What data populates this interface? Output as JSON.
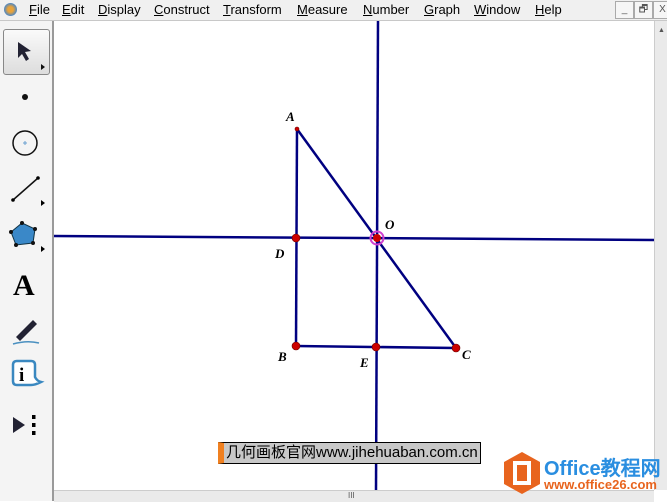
{
  "menu": [
    "File",
    "Edit",
    "Display",
    "Construct",
    "Transform",
    "Measure",
    "Number",
    "Graph",
    "Window",
    "Help"
  ],
  "window_buttons": [
    "_",
    "🗗",
    "X"
  ],
  "tools": [
    "arrow-tool",
    "point-tool",
    "compass-tool",
    "straightedge-tool",
    "polygon-tool",
    "text-tool",
    "marker-tool",
    "information-tool",
    "custom-tool"
  ],
  "points": {
    "A": "A",
    "B": "B",
    "C": "C",
    "D": "D",
    "E": "E",
    "O": "O"
  },
  "caption": "几何画板官网www.jihehuaban.com.cn",
  "watermark": {
    "title": "Office教程网",
    "url": "www.office26.com"
  },
  "colors": {
    "line": "#000080",
    "point": "#cc0000",
    "accent": "#f08020",
    "logo": "#e8641e"
  },
  "hscroll_grip": "III"
}
